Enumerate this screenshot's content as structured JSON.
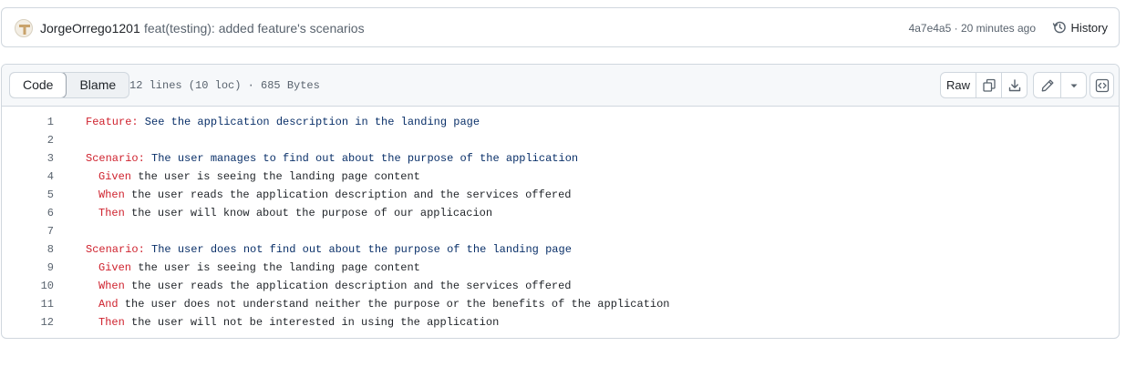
{
  "commit": {
    "author": "JorgeOrrego1201",
    "message": "feat(testing): added feature's scenarios",
    "meta": "4a7e4a5 · 20 minutes ago",
    "history_label": "History"
  },
  "file_header": {
    "tabs": [
      "Code",
      "Blame"
    ],
    "active_tab": "Code",
    "info": "12 lines (10 loc) · 685 Bytes",
    "raw_label": "Raw"
  },
  "colors": {
    "keyword": "#cf222e",
    "string": "#0a3069",
    "text": "#1f2328",
    "muted": "#59636e",
    "border": "#d0d7de"
  },
  "lines": [
    {
      "n": "1",
      "indent": 0,
      "kw": "Feature:",
      "text": " See the application description in the landing page",
      "style": "string"
    },
    {
      "n": "2",
      "indent": 0,
      "kw": "",
      "text": "",
      "style": "string"
    },
    {
      "n": "3",
      "indent": 0,
      "kw": "Scenario:",
      "text": " The user manages to find out about the purpose of the application",
      "style": "string"
    },
    {
      "n": "4",
      "indent": 1,
      "kw": "Given",
      "text": " the user is seeing the landing page content",
      "style": "plain"
    },
    {
      "n": "5",
      "indent": 1,
      "kw": "When",
      "text": " the user reads the application description and the services offered",
      "style": "plain"
    },
    {
      "n": "6",
      "indent": 1,
      "kw": "Then",
      "text": " the user will know about the purpose of our applicacion",
      "style": "plain"
    },
    {
      "n": "7",
      "indent": 0,
      "kw": "",
      "text": "",
      "style": "string"
    },
    {
      "n": "8",
      "indent": 0,
      "kw": "Scenario:",
      "text": " The user does not find out about the purpose of the landing page",
      "style": "string"
    },
    {
      "n": "9",
      "indent": 1,
      "kw": "Given",
      "text": " the user is seeing the landing page content",
      "style": "plain"
    },
    {
      "n": "10",
      "indent": 1,
      "kw": "When",
      "text": " the user reads the application description and the services offered",
      "style": "plain"
    },
    {
      "n": "11",
      "indent": 1,
      "kw": "And",
      "text": " the user does not understand neither the purpose or the benefits of the application",
      "style": "plain"
    },
    {
      "n": "12",
      "indent": 1,
      "kw": "Then",
      "text": " the user will not be interested in using the application",
      "style": "plain"
    }
  ]
}
